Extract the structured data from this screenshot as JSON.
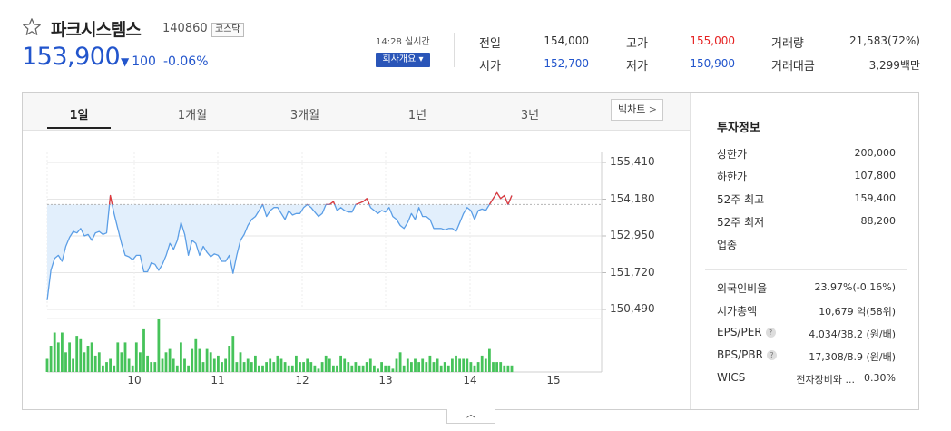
{
  "stock": {
    "name": "파크시스템스",
    "code": "140860",
    "market_badge": "코스닥",
    "price": "153,900",
    "change_arrow": "▼",
    "change": "100",
    "change_pct": "-0.06%",
    "time": "14:28 실시간",
    "company_button": "회사개요 ▾"
  },
  "quote": [
    {
      "label": "전일",
      "value": "154,000",
      "tone": "dark"
    },
    {
      "label": "고가",
      "value": "155,000",
      "tone": "red"
    },
    {
      "label": "거래량",
      "value": "21,583(72%)",
      "tone": "dark"
    },
    {
      "label": "시가",
      "value": "152,700",
      "tone": "blue"
    },
    {
      "label": "저가",
      "value": "150,900",
      "tone": "blue"
    },
    {
      "label": "거래대금",
      "value": "3,299백만",
      "tone": "dark"
    }
  ],
  "tabs": [
    "1일",
    "1개월",
    "3개월",
    "1년",
    "3년"
  ],
  "big_chart": "빅차트",
  "info": {
    "title": "투자정보",
    "group1": [
      {
        "label": "상한가",
        "value": "200,000",
        "tone": "red"
      },
      {
        "label": "하한가",
        "value": "107,800",
        "tone": "blue"
      },
      {
        "label": "52주 최고",
        "value": "159,400",
        "tone": "dark"
      },
      {
        "label": "52주 최저",
        "value": "88,200",
        "tone": "dark"
      },
      {
        "label": "업종",
        "value": "",
        "tone": "dark"
      }
    ],
    "group2": [
      {
        "label": "외국인비율",
        "value": "23.97%(-0.16%)",
        "help": false
      },
      {
        "label": "시가총액",
        "value": "10,679 억(58위)",
        "help": false
      },
      {
        "label": "EPS/PER",
        "value": "4,034/38.2 (원/배)",
        "help": true
      },
      {
        "label": "BPS/PBR",
        "value": "17,308/8.9 (원/배)",
        "help": true
      }
    ],
    "wics_label": "WICS",
    "wics_sector": "전자장비와 ...",
    "wics_pct": "0.30%"
  },
  "chart_data": {
    "type": "line",
    "y_ticks": [
      "155,410",
      "154,180",
      "152,950",
      "151,720",
      "150,490"
    ],
    "ylim": [
      150490,
      155410
    ],
    "x_ticks": [
      "10",
      "11",
      "12",
      "13",
      "14",
      "15"
    ],
    "baseline": 154000,
    "colors": {
      "up": "#e23b3b",
      "down": "#5b9ee6",
      "fill": "#e2effc",
      "volume": "#46c35a"
    },
    "x": [
      0,
      1,
      2,
      3,
      4,
      5,
      6,
      7,
      8,
      9,
      10,
      11,
      12,
      13,
      14,
      15,
      16,
      17,
      18,
      19,
      20,
      21,
      22,
      23,
      24,
      25,
      26,
      27,
      28,
      29,
      30,
      31,
      32,
      33,
      34,
      35,
      36,
      37,
      38,
      39,
      40,
      41,
      42,
      43,
      44,
      45,
      46,
      47,
      48,
      49,
      50,
      51,
      52,
      53,
      54,
      55,
      56,
      57,
      58,
      59,
      60,
      61,
      62,
      63,
      64,
      65,
      66,
      67,
      68,
      69,
      70,
      71,
      72,
      73,
      74,
      75,
      76,
      77,
      78,
      79,
      80,
      81,
      82,
      83,
      84,
      85,
      86,
      87,
      88,
      89,
      90,
      91,
      92,
      93,
      94,
      95,
      96,
      97,
      98,
      99,
      100,
      101,
      102,
      103,
      104,
      105,
      106,
      107,
      108,
      109,
      110,
      111,
      112,
      113,
      114,
      115,
      116,
      117,
      118,
      119,
      120,
      121,
      122,
      123,
      124,
      125
    ],
    "price": [
      150800,
      151800,
      152200,
      152300,
      152100,
      152600,
      152900,
      153100,
      153050,
      153200,
      152950,
      153000,
      152800,
      153050,
      153100,
      153000,
      153050,
      154300,
      153700,
      153200,
      152700,
      152300,
      152250,
      152150,
      152300,
      152300,
      151750,
      151750,
      152050,
      152000,
      151800,
      152000,
      152300,
      152700,
      152500,
      152800,
      153400,
      153000,
      152300,
      152800,
      152700,
      152300,
      152600,
      152400,
      152250,
      152350,
      152300,
      152100,
      152100,
      152300,
      151700,
      152300,
      152800,
      153000,
      153300,
      153500,
      153600,
      153800,
      154000,
      153600,
      153800,
      153900,
      153900,
      153700,
      153500,
      153800,
      153650,
      153700,
      153700,
      153900,
      154000,
      153900,
      153750,
      153600,
      153700,
      154000,
      154000,
      154100,
      153800,
      153900,
      153800,
      153750,
      153750,
      154000,
      154050,
      154100,
      154200,
      153900,
      153800,
      153700,
      153800,
      153750,
      153900,
      153600,
      153500,
      153300,
      153200,
      153400,
      153700,
      153500,
      153900,
      153600,
      153600,
      153500,
      153200,
      153200,
      153200,
      153150,
      153200,
      153200,
      153100,
      153400,
      153700,
      153900,
      153800,
      153500,
      153800,
      153850,
      153800,
      154000,
      154200,
      154400,
      154200,
      154300,
      154000,
      154300
    ],
    "volume": [
      20,
      40,
      60,
      45,
      60,
      30,
      45,
      20,
      55,
      50,
      30,
      40,
      45,
      25,
      30,
      10,
      15,
      20,
      10,
      45,
      30,
      45,
      20,
      10,
      45,
      30,
      65,
      25,
      15,
      15,
      80,
      20,
      30,
      35,
      20,
      10,
      45,
      20,
      10,
      35,
      50,
      35,
      15,
      35,
      30,
      20,
      25,
      15,
      20,
      40,
      55,
      15,
      30,
      15,
      20,
      15,
      25,
      10,
      10,
      15,
      20,
      15,
      25,
      20,
      15,
      10,
      10,
      25,
      15,
      15,
      20,
      15,
      10,
      5,
      15,
      25,
      20,
      10,
      10,
      25,
      20,
      15,
      10,
      15,
      10,
      10,
      15,
      20,
      10,
      5,
      15,
      10,
      10,
      5,
      20,
      30,
      10,
      20,
      15,
      20,
      15,
      20,
      15,
      25,
      15,
      20,
      10,
      15,
      10,
      20,
      25,
      20,
      20,
      20,
      15,
      10,
      15,
      25,
      20,
      35,
      15,
      15,
      15,
      10,
      10,
      10
    ]
  }
}
